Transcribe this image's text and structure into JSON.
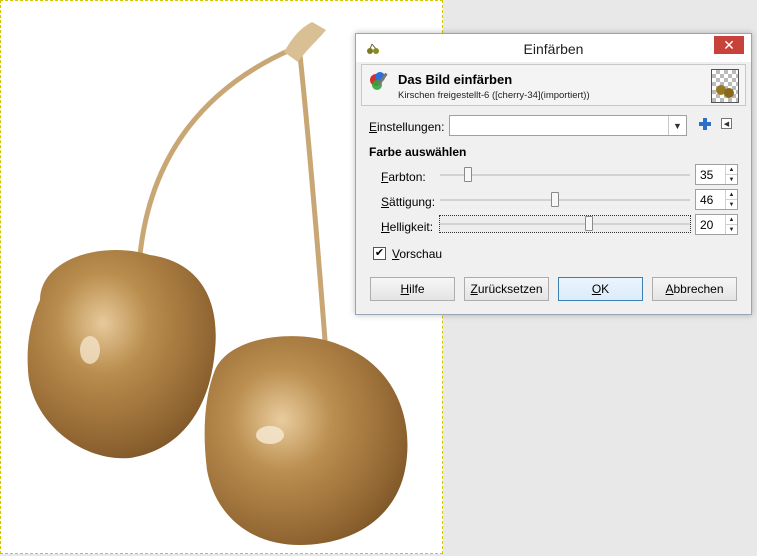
{
  "dialog": {
    "title": "Einfärben",
    "close_glyph": "✕",
    "header_title": "Das Bild einfärben",
    "header_subtitle": "Kirschen freigestellt-6 ([cherry-34](importiert))",
    "presets_label_underlined": "E",
    "presets_label_rest": "instellungen:",
    "presets_value": "",
    "section_label": "Farbe auswählen",
    "sliders": [
      {
        "label_u": "F",
        "label_rest": "arbton:",
        "value": "35",
        "level": 0.1
      },
      {
        "label_u": "S",
        "label_rest": "ättigung:",
        "value": "46",
        "level": 0.46
      },
      {
        "label_u": "H",
        "label_rest": "elligkeit:",
        "value": "20",
        "level": 0.6
      }
    ],
    "preview_checked": true,
    "preview_label_u": "V",
    "preview_label_rest": "orschau",
    "buttons": {
      "help_u": "H",
      "help_rest": "ilfe",
      "reset_u": "Z",
      "reset_rest": "urücksetzen",
      "ok_u": "O",
      "ok_rest": "K",
      "cancel_u": "A",
      "cancel_rest": "bbrechen"
    }
  },
  "icons": {
    "title": "cherry-app-icon",
    "header": "colorize-tool-icon",
    "add": "plus-icon",
    "menu": "tab-menu-icon",
    "combo_arrow": "chevron-down-icon"
  },
  "colors": {
    "cherry_fill": "#b58a4a",
    "cherry_dark": "#8a6230",
    "stem": "#caa876",
    "close_button": "#c7423b",
    "default_button_border": "#3c7fb1"
  }
}
